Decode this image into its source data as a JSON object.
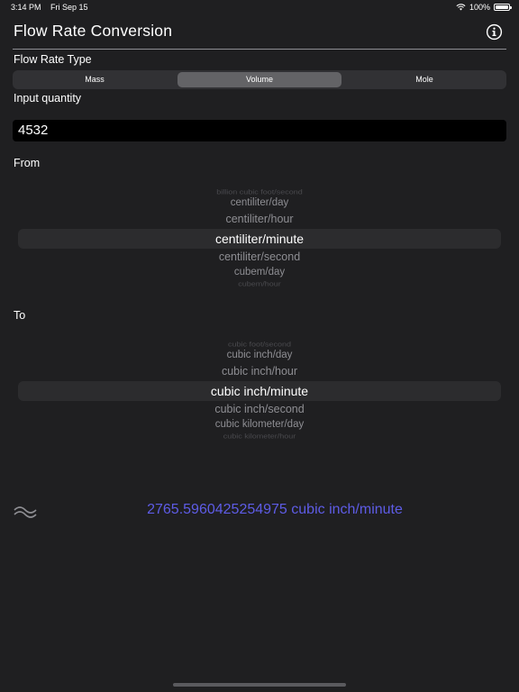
{
  "status": {
    "time": "3:14 PM",
    "date": "Fri Sep 15",
    "battery": "100%"
  },
  "nav": {
    "title": "Flow Rate Conversion",
    "info_icon": "info-circle-icon"
  },
  "flow_rate_type": {
    "label": "Flow Rate Type",
    "segments": [
      "Mass",
      "Volume",
      "Mole"
    ],
    "selected": "Volume"
  },
  "input": {
    "label": "Input quantity",
    "value": "4532"
  },
  "from": {
    "label": "From",
    "above_faint": "billion cubic foot/second",
    "items": [
      "centiliter/day",
      "centiliter/hour",
      "centiliter/minute",
      "centiliter/second",
      "cubem/day"
    ],
    "below_faint": "cubem/hour",
    "selected": "centiliter/minute"
  },
  "to": {
    "label": "To",
    "above_faint": "cubic foot/second",
    "items": [
      "cubic inch/day",
      "cubic inch/hour",
      "cubic inch/minute",
      "cubic inch/second",
      "cubic kilometer/day"
    ],
    "below_faint": "cubic kilometer/hour",
    "selected": "cubic inch/minute"
  },
  "result": {
    "icon": "approximately-equal-icon",
    "text": "2765.5960425254975 cubic inch/minute",
    "color": "#5e5ce6"
  }
}
